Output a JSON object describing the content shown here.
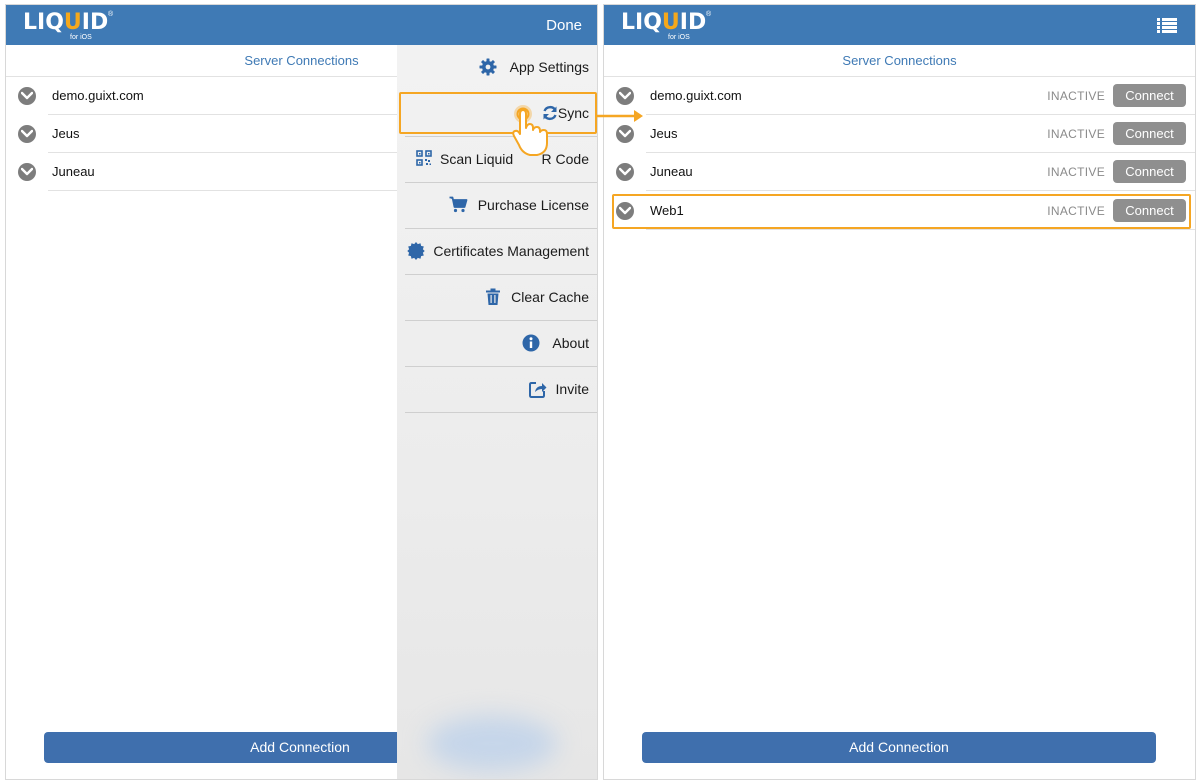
{
  "app": {
    "logo_text_left": "LIQ",
    "logo_text_u": "U",
    "logo_text_right": "ID",
    "logo_sub": "for iOS",
    "logo_reg": "®"
  },
  "left_screen": {
    "done_label": "Done",
    "section_title": "Server Connections",
    "connections": [
      {
        "name": "demo.guixt.com"
      },
      {
        "name": "Jeus"
      },
      {
        "name": "Juneau"
      }
    ],
    "add_button": "Add Connection"
  },
  "menu": {
    "items": [
      {
        "label": "App Settings",
        "icon": "gear-icon"
      },
      {
        "label": "Sync",
        "icon": "sync-icon"
      },
      {
        "label": "Scan Liquid QR Code",
        "visible_label": "Scan Liquid",
        "tail_label": "R Code",
        "icon": "qr-code-icon"
      },
      {
        "label": "Purchase License",
        "icon": "cart-icon"
      },
      {
        "label": "Certificates Management",
        "icon": "certificate-icon"
      },
      {
        "label": "Clear Cache",
        "icon": "trash-icon"
      },
      {
        "label": "About",
        "icon": "info-icon"
      },
      {
        "label": "Invite",
        "icon": "share-icon"
      }
    ]
  },
  "right_screen": {
    "section_title": "Server Connections",
    "connections": [
      {
        "name": "demo.guixt.com",
        "status": "INACTIVE",
        "action": "Connect"
      },
      {
        "name": "Jeus",
        "status": "INACTIVE",
        "action": "Connect"
      },
      {
        "name": "Juneau",
        "status": "INACTIVE",
        "action": "Connect"
      },
      {
        "name": "Web1",
        "status": "INACTIVE",
        "action": "Connect"
      }
    ],
    "add_button": "Add Connection"
  },
  "colors": {
    "header_blue": "#3f7ab5",
    "button_blue": "#3f6fad",
    "highlight_orange": "#f5a623",
    "connect_gray": "#8f8f8f"
  }
}
